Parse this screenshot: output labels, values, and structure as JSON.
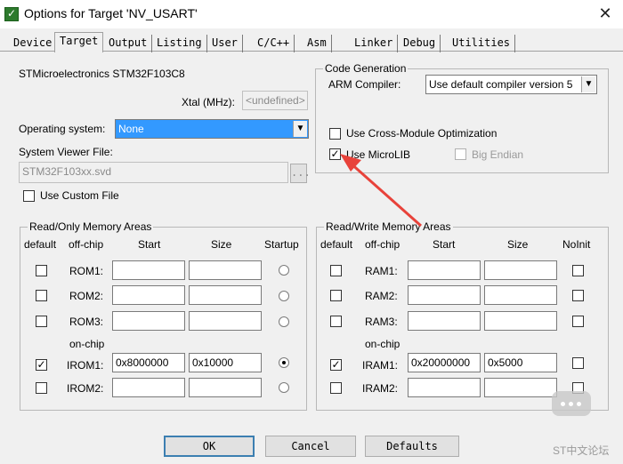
{
  "window": {
    "title": "Options for Target 'NV_USART'",
    "close": "✕"
  },
  "tabs": [
    "Device",
    "Target",
    "Output",
    "Listing",
    "User",
    "C/C++",
    "Asm",
    "Linker",
    "Debug",
    "Utilities"
  ],
  "device": {
    "name": "STMicroelectronics STM32F103C8",
    "xtal_label": "Xtal (MHz):",
    "xtal_value": "<undefined>",
    "os_label": "Operating system:",
    "os_value": "None",
    "svf_label": "System Viewer File:",
    "svf_value": "STM32F103xx.svd",
    "browse": "...",
    "custom_file": "Use Custom File"
  },
  "code_gen": {
    "title": "Code Generation",
    "compiler_label": "ARM Compiler:",
    "compiler_value": "Use default compiler version 5",
    "cross_module": "Use Cross-Module Optimization",
    "microlib": "Use MicroLIB",
    "big_endian": "Big Endian",
    "microlib_checked": true,
    "cross_module_checked": false
  },
  "ro_mem": {
    "title": "Read/Only Memory Areas",
    "headers": [
      "default",
      "off-chip",
      "Start",
      "Size",
      "Startup"
    ],
    "onchip_label": "on-chip",
    "rows": [
      {
        "name": "ROM1:",
        "start": "",
        "size": "",
        "default": false,
        "startup": false
      },
      {
        "name": "ROM2:",
        "start": "",
        "size": "",
        "default": false,
        "startup": false
      },
      {
        "name": "ROM3:",
        "start": "",
        "size": "",
        "default": false,
        "startup": false
      },
      {
        "name": "IROM1:",
        "start": "0x8000000",
        "size": "0x10000",
        "default": true,
        "startup": true
      },
      {
        "name": "IROM2:",
        "start": "",
        "size": "",
        "default": false,
        "startup": false
      }
    ]
  },
  "rw_mem": {
    "title": "Read/Write Memory Areas",
    "headers": [
      "default",
      "off-chip",
      "Start",
      "Size",
      "NoInit"
    ],
    "onchip_label": "on-chip",
    "rows": [
      {
        "name": "RAM1:",
        "start": "",
        "size": "",
        "default": false
      },
      {
        "name": "RAM2:",
        "start": "",
        "size": "",
        "default": false
      },
      {
        "name": "RAM3:",
        "start": "",
        "size": "",
        "default": false
      },
      {
        "name": "IRAM1:",
        "start": "0x20000000",
        "size": "0x5000",
        "default": true
      },
      {
        "name": "IRAM2:",
        "start": "",
        "size": "",
        "default": false
      }
    ]
  },
  "buttons": {
    "ok": "OK",
    "cancel": "Cancel",
    "defaults": "Defaults"
  },
  "watermark": "ST中文论坛",
  "colors": {
    "arrow": "#e8423a",
    "selection": "#3399ff"
  }
}
